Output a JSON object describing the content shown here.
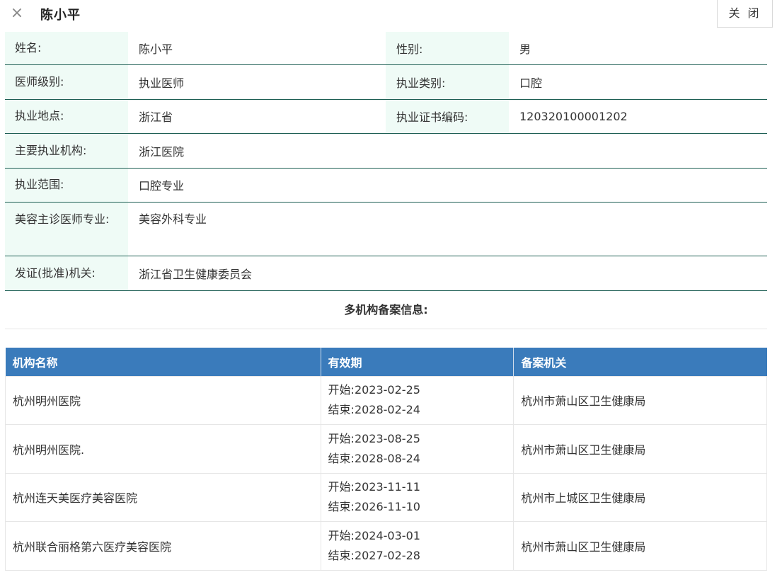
{
  "header": {
    "close_icon": "×",
    "title": "陈小平",
    "close_button": "关 闭"
  },
  "info": {
    "name_label": "姓名:",
    "name_value": "陈小平",
    "gender_label": "性别:",
    "gender_value": "男",
    "level_label": "医师级别:",
    "level_value": "执业医师",
    "category_label": "执业类别:",
    "category_value": "口腔",
    "location_label": "执业地点:",
    "location_value": "浙江省",
    "cert_label": "执业证书编码:",
    "cert_value": "120320100001202",
    "institution_label": "主要执业机构:",
    "institution_value": "浙江医院",
    "scope_label": "执业范围:",
    "scope_value": "口腔专业",
    "cosmetic_label": "美容主诊医师专业:",
    "cosmetic_value": "美容外科专业",
    "issuer_label": "发证(批准)机关:",
    "issuer_value": "浙江省卫生健康委员会"
  },
  "records": {
    "title": "多机构备案信息:",
    "headers": [
      "机构名称",
      "有效期",
      "备案机关"
    ],
    "rows": [
      {
        "name": "杭州明州医院",
        "start": "开始:2023-02-25",
        "end": "结束:2028-02-24",
        "authority": "杭州市萧山区卫生健康局"
      },
      {
        "name": "杭州明州医院.",
        "start": "开始:2023-08-25",
        "end": "结束:2028-08-24",
        "authority": "杭州市萧山区卫生健康局"
      },
      {
        "name": "杭州连天美医疗美容医院",
        "start": "开始:2023-11-11",
        "end": "结束:2026-11-10",
        "authority": "杭州市上城区卫生健康局"
      },
      {
        "name": "杭州联合丽格第六医疗美容医院",
        "start": "开始:2024-03-01",
        "end": "结束:2027-02-28",
        "authority": "杭州市萧山区卫生健康局"
      }
    ]
  }
}
